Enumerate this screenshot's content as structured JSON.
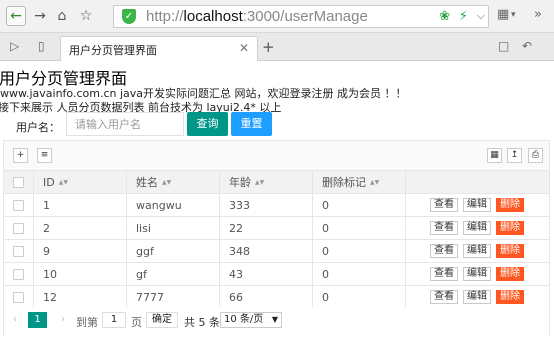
{
  "browser": {
    "url_scheme": "http://",
    "url_host": "localhost",
    "url_rest": ":3000/userManage",
    "tab_title": "用户分页管理界面"
  },
  "page": {
    "title": "用户分页管理界面",
    "line1": "www.javainfo.com.cn java开发实际问题汇总 网站，欢迎登录注册 成为会员 ！！",
    "line2": "接下来展示 人员分页数据列表 前台技术为 layui2.4* 以上",
    "search_label": "用户名：",
    "search_placeholder": "请输入用户名",
    "search_button": "查询",
    "reset_button": "重置"
  },
  "table": {
    "columns": [
      "ID",
      "姓名",
      "年龄",
      "删除标记"
    ],
    "rows": [
      {
        "id": "1",
        "name": "wangwu",
        "age": "333",
        "deleted": "0"
      },
      {
        "id": "2",
        "name": "lisi",
        "age": "22",
        "deleted": "0"
      },
      {
        "id": "9",
        "name": "ggf",
        "age": "348",
        "deleted": "0"
      },
      {
        "id": "10",
        "name": "gf",
        "age": "43",
        "deleted": "0"
      },
      {
        "id": "12",
        "name": "7777",
        "age": "66",
        "deleted": "0"
      }
    ],
    "actions": {
      "view": "查看",
      "edit": "编辑",
      "delete": "删除"
    }
  },
  "pager": {
    "current_page": "1",
    "goto_label": "到第",
    "goto_value": "1",
    "page_label": "页",
    "confirm": "确定",
    "total": "共 5 条",
    "page_size": "10 条/页"
  },
  "colors": {
    "primary": "#009688",
    "reset": "#1e9fff",
    "danger": "#ff5722"
  }
}
